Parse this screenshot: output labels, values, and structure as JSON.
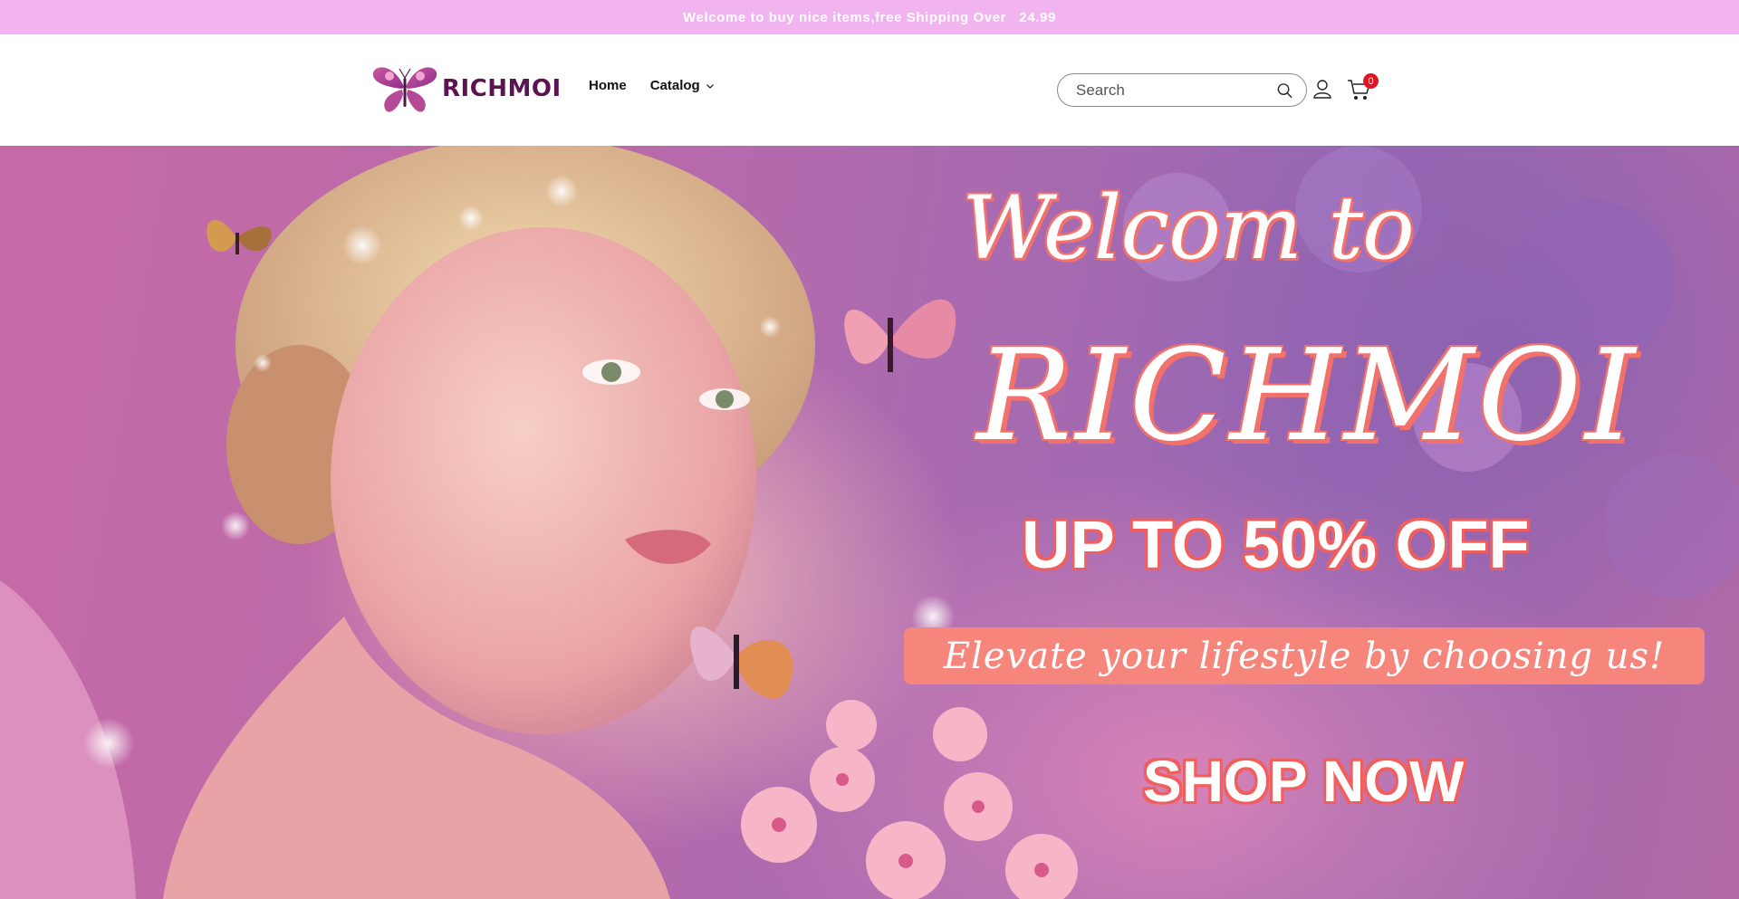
{
  "announcement": {
    "text": "Welcome to buy nice items,free Shipping Over   24.99"
  },
  "header": {
    "logo_text": "RICHMOI",
    "nav": [
      {
        "label": "Home"
      },
      {
        "label": "Catalog"
      }
    ],
    "search": {
      "placeholder": "Search",
      "value": ""
    },
    "cart_count": "0"
  },
  "hero": {
    "welcome": "Welcom to",
    "brand": "RICHMOI",
    "offer": "UP TO 50% OFF",
    "tagline": "Elevate your lifestyle by choosing us!",
    "cta": "SHOP NOW"
  },
  "colors": {
    "announcement_bg": "#f2b3f1",
    "accent_coral": "#f6857b",
    "badge_red": "#e0141e",
    "logo_purple": "#5b1450"
  },
  "icons": [
    "butterfly-logo-icon",
    "chevron-down-icon",
    "search-icon",
    "account-icon",
    "cart-icon"
  ]
}
